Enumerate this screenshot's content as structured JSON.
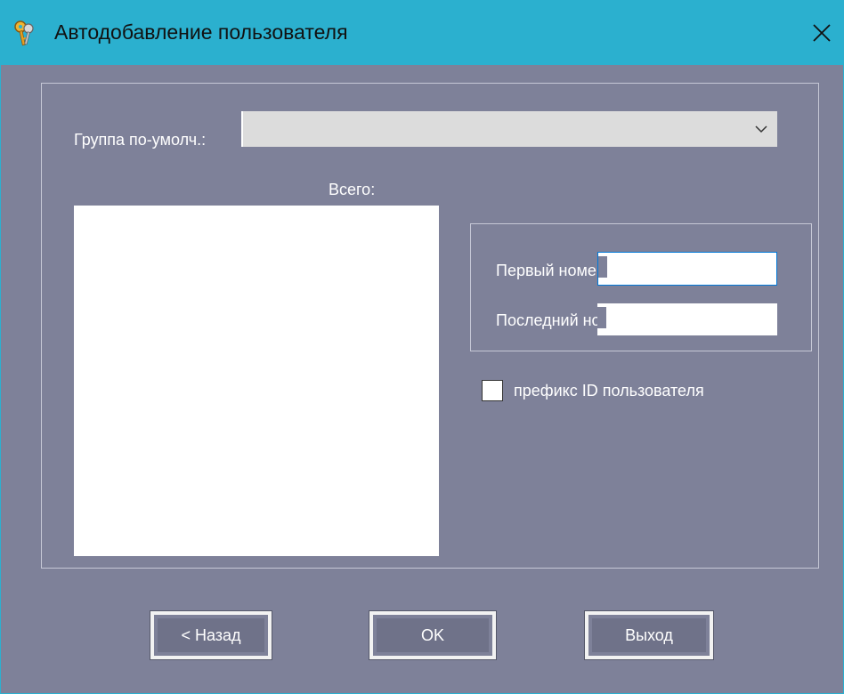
{
  "window": {
    "title": "Автодобавление пользователя",
    "title_bar_color": "#2bb0cf",
    "background_color": "#7e8199",
    "app_icon": "keys-icon",
    "close_icon": "close-icon"
  },
  "form": {
    "default_group_label": "Группа по-умолч.:",
    "default_group_value": "",
    "total_label": "Всего:",
    "total_list_items": [],
    "first_number_label": "Первый номер",
    "first_number_value": "",
    "last_number_label": "Последний номер",
    "last_number_value": "",
    "prefix_checkbox_label": "префикс ID пользователя",
    "prefix_checked": false
  },
  "buttons": {
    "back": "< Назад",
    "ok": "OK",
    "exit": "Выход"
  }
}
